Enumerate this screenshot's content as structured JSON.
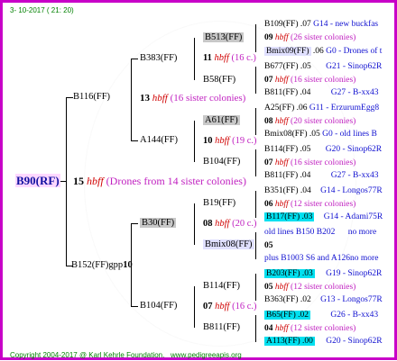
{
  "header": {
    "date": "3- 10-2017 ( 21: 20)"
  },
  "footer": {
    "copyright": "Copyright 2004-2017 @ Karl Kehrle Foundation.",
    "site": "www.pedigreeapis.org"
  },
  "root": {
    "name": "B90(RF)",
    "gen": "15",
    "hbff": "hbff",
    "info": "(Drones from 14 sister colonies)"
  },
  "father": {
    "name": "B116(FF)",
    "gen": "13",
    "hbff": "hbff",
    "info": "(16 sister colonies)"
  },
  "mother": {
    "name": "B152(FF)gpp",
    "gen": "10"
  },
  "nodes": {
    "b383": "B383(FF)",
    "b513": "B513(FF)",
    "b513_gen": "11",
    "b513_hbff": "hbff",
    "b513_info": "(16 c.)",
    "b58": "B58(FF)",
    "a144": "A144(FF)",
    "a61": "A61(FF)",
    "a61_gen": "10",
    "a61_hbff": "hbff",
    "a61_info": "(19 c.)",
    "b104a": "B104(FF)",
    "b30": "B30(FF)",
    "b19": "B19(FF)",
    "b19_gen": "08",
    "b19_hbff": "hbff",
    "b19_info": "(20 c.)",
    "bmix08": "Bmix08(FF)",
    "b104b": "B104(FF)",
    "b114": "B114(FF)",
    "b114_gen": "07",
    "b114_hbff": "hbff",
    "b114_info": "(16 c.)",
    "b811": "B811(FF)"
  },
  "leaves": [
    {
      "pre": "B109(FF)",
      "num": ".07",
      "tail": "G14 - new buckfas"
    },
    {
      "gen": "09",
      "hbff": "hbff",
      "info": "(26 sister colonies)"
    },
    {
      "pre": "Bmix09(FF)",
      "num": ".06",
      "tail": "G0 - Drones of t"
    },
    {
      "pre": "B677(FF)",
      "num": ".05",
      "tail": "G21 - Sinop62R"
    },
    {
      "gen": "07",
      "hbff": "hbff",
      "info": "(16 sister colonies)"
    },
    {
      "pre": "B811(FF)",
      "num": ".04",
      "tail": "G27 - B-xx43"
    },
    {
      "pre": "A25(FF)",
      "num": ".06",
      "tail": "G11 - ErzurumEgg8"
    },
    {
      "gen": "08",
      "hbff": "hbff",
      "info": "(20 sister colonies)"
    },
    {
      "pre": "Bmix08(FF)",
      "num": ".05",
      "tail": "G0 - old lines B"
    },
    {
      "pre": "B114(FF)",
      "num": ".05",
      "tail": "G20 - Sinop62R"
    },
    {
      "gen": "07",
      "hbff": "hbff",
      "info": "(16 sister colonies)"
    },
    {
      "pre": "B811(FF)",
      "num": ".04",
      "tail": "G27 - B-xx43"
    },
    {
      "pre": "B351(FF)",
      "num": ".04",
      "tail": "G14 - Longos77R"
    },
    {
      "gen": "06",
      "hbff": "hbff",
      "info": "(12 sister colonies)"
    },
    {
      "pre": "B117(FF)",
      "num": ".03",
      "tail": "G14 - Adami75R"
    },
    {
      "pre": "old lines B150 B202",
      "num": "",
      "tail": "no more"
    },
    {
      "gen": "05"
    },
    {
      "pre": "plus B1003 S6 and A126",
      "num": "",
      "tail": "no more"
    },
    {
      "pre": "B203(FF)",
      "num": ".03",
      "tail": "G19 - Sinop62R"
    },
    {
      "gen": "05",
      "hbff": "hbff",
      "info": "(12 sister colonies)"
    },
    {
      "pre": "B363(FF)",
      "num": ".02",
      "tail": "G13 - Longos77R"
    },
    {
      "pre": "B65(FF)",
      "num": ".02",
      "tail": "G26 - B-xx43"
    },
    {
      "gen": "04",
      "hbff": "hbff",
      "info": "(12 sister colonies)"
    },
    {
      "pre": "A113(FF)",
      "num": ".00",
      "tail": "G20 - Sinop62R"
    }
  ],
  "colors": {
    "frame": "#c800c8",
    "highlight": "#00e0f0",
    "grey_box": "#c8c8c8",
    "green": "#008000",
    "blue": "#1010d0",
    "magenta": "#c020c0",
    "red": "#d00000"
  }
}
